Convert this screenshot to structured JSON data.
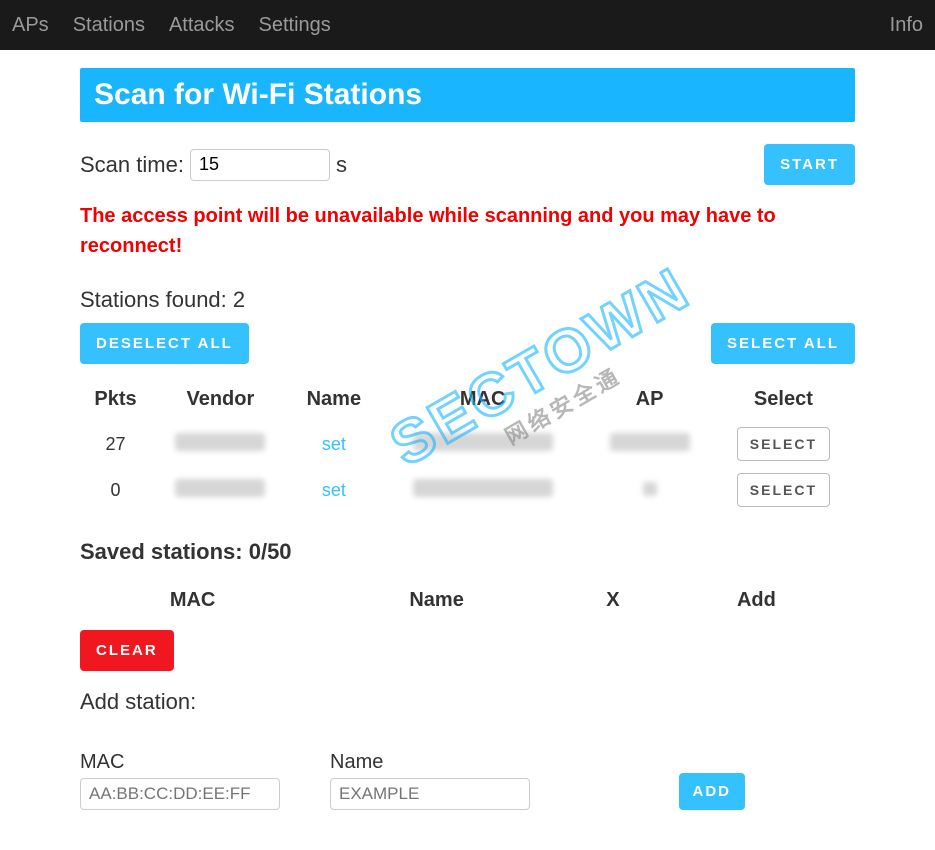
{
  "nav": {
    "items": [
      "APs",
      "Stations",
      "Attacks",
      "Settings"
    ],
    "right": "Info"
  },
  "title": "Scan for Wi-Fi Stations",
  "scan": {
    "label": "Scan time:",
    "value": "15",
    "unit": "s",
    "start": "START"
  },
  "warning": "The access point will be unavailable while scanning and you may have to reconnect!",
  "found": {
    "label": "Stations found: 2",
    "deselect": "DESELECT ALL",
    "selectall": "SELECT ALL"
  },
  "stations_table": {
    "headers": [
      "Pkts",
      "Vendor",
      "Name",
      "MAC",
      "AP",
      "Select"
    ],
    "rows": [
      {
        "pkts": "27",
        "name_action": "set",
        "select": "SELECT"
      },
      {
        "pkts": "0",
        "name_action": "set",
        "select": "SELECT"
      }
    ]
  },
  "saved": {
    "label": "Saved stations: 0/50",
    "headers": [
      "MAC",
      "Name",
      "X",
      "Add"
    ],
    "clear": "CLEAR"
  },
  "add": {
    "title": "Add station:",
    "mac_label": "MAC",
    "mac_placeholder": "AA:BB:CC:DD:EE:FF",
    "name_label": "Name",
    "name_placeholder": "EXAMPLE",
    "button": "ADD"
  },
  "watermark": {
    "big": "SECTOWN",
    "cn": "网络安全通"
  }
}
